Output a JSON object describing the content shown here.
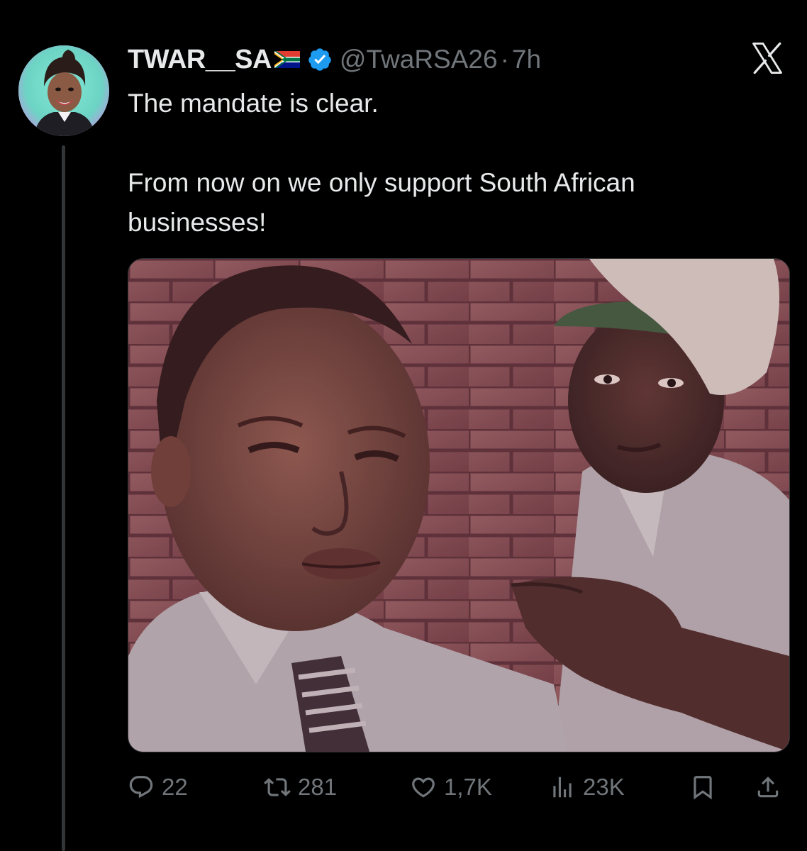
{
  "author": {
    "display_name": "TWAR__SA",
    "handle": "@TwaRSA26",
    "separator": "·",
    "time": "7h",
    "flag_icon": "south-africa-flag-icon",
    "verified_icon": "verified-badge-icon"
  },
  "tweet": {
    "line1": "The mandate is clear.",
    "line2": "From now on we only support South African",
    "line3": "businesses!"
  },
  "actions": {
    "replies": "22",
    "reposts": "281",
    "likes": "1,7K",
    "views": "23K"
  },
  "icons": {
    "close": "x-logo-icon",
    "reply": "reply-icon",
    "repost": "repost-icon",
    "like": "heart-icon",
    "views": "views-icon",
    "bookmark": "bookmark-icon",
    "share": "share-icon"
  },
  "colors": {
    "background": "#000000",
    "text": "#e7e9ea",
    "muted": "#71767b",
    "verified": "#1d9bf0",
    "thread_line": "#333639"
  }
}
